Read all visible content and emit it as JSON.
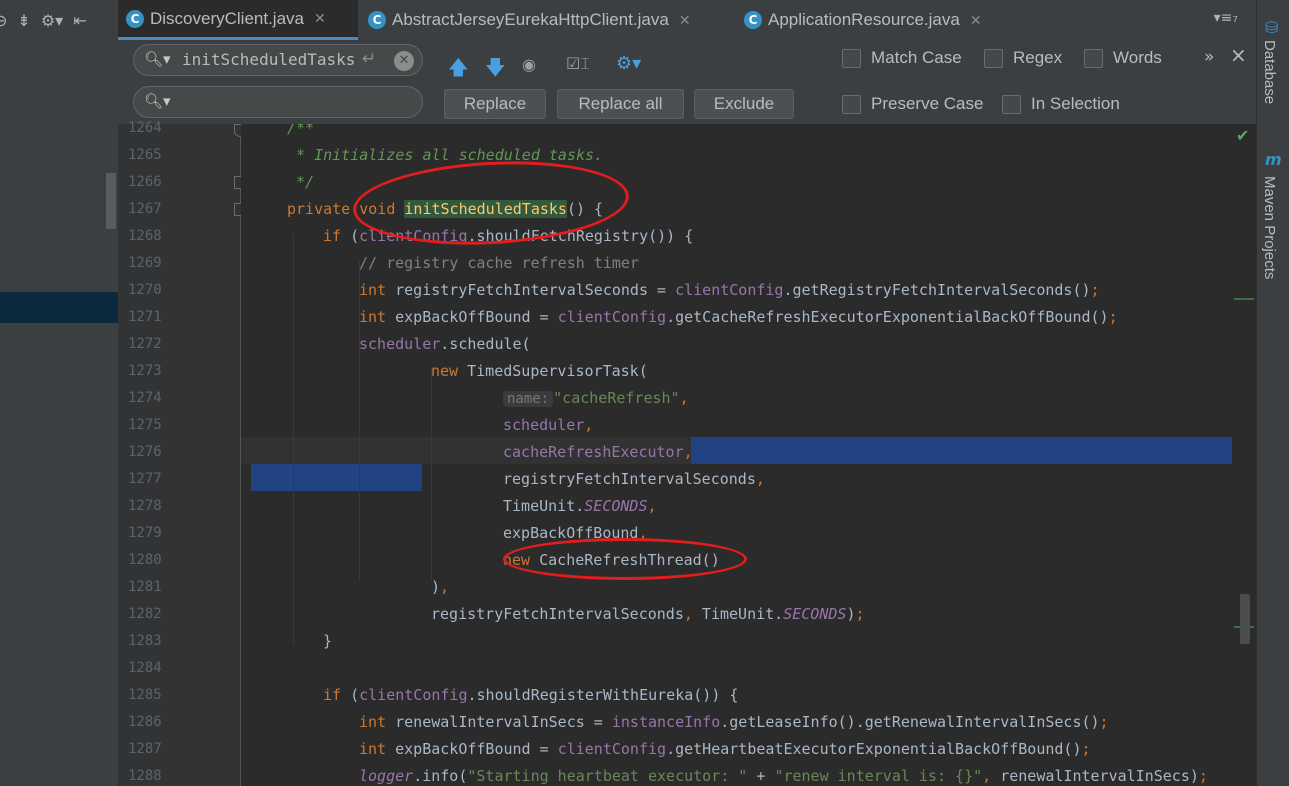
{
  "toolbar": {
    "icons": [
      "globe-icon",
      "collapse-icon",
      "gear-icon",
      "hide-icon"
    ]
  },
  "tabs": [
    {
      "label": "DiscoveryClient.java",
      "icon": "C",
      "active": true
    },
    {
      "label": "AbstractJerseyEurekaHttpClient.java",
      "icon": "C",
      "active": false
    },
    {
      "label": "ApplicationResource.java",
      "icon": "C",
      "active": false
    }
  ],
  "tab_menu": "▾≡₇",
  "find": {
    "search_value": "initScheduledTasks",
    "replace_value": "",
    "buttons": {
      "replace": "Replace",
      "replace_all": "Replace all",
      "exclude": "Exclude"
    },
    "options": {
      "match_case": "Match Case",
      "regex": "Regex",
      "words": "Words",
      "preserve_case": "Preserve Case",
      "in_selection": "In Selection"
    },
    "more": "»",
    "close": "×"
  },
  "gutter": {
    "lines": [
      "1264",
      "1265",
      "1266",
      "1267",
      "1268",
      "1269",
      "1270",
      "1271",
      "1272",
      "1273",
      "1274",
      "1275",
      "1276",
      "1277",
      "1278",
      "1279",
      "1280",
      "1281",
      "1282",
      "1283",
      "1284",
      "1285",
      "1286",
      "1287",
      "1288"
    ]
  },
  "code": {
    "l1264": "/**",
    "l1265": " * Initializes all scheduled tasks.",
    "l1266": " */",
    "l1267": {
      "kw1": "private",
      "kw2": "void",
      "name": "initScheduledTasks",
      "rest": "() {"
    },
    "l1268": {
      "kw": "if",
      "open": " (",
      "field": "clientConfig",
      "rest": ".shouldFetchRegistry()) {"
    },
    "l1269": "// registry cache refresh timer",
    "l1270": {
      "kw": "int",
      "mid": " registryFetchIntervalSeconds = ",
      "field": "clientConfig",
      "rest": ".getRegistryFetchIntervalSeconds()",
      "semi": ";"
    },
    "l1271": {
      "kw": "int",
      "mid": " expBackOffBound = ",
      "field": "clientConfig",
      "rest": ".getCacheRefreshExecutorExponentialBackOffBound()",
      "semi": ";"
    },
    "l1272": {
      "field": "scheduler",
      "rest": ".schedule("
    },
    "l1273": {
      "kw": "new",
      "rest": " TimedSupervisorTask("
    },
    "l1274": {
      "hint": "name:",
      "str": "\"cacheRefresh\"",
      "comma": ","
    },
    "l1275": {
      "field": "scheduler",
      "comma": ","
    },
    "l1276": {
      "field": "cacheRefreshExecutor",
      "comma": ","
    },
    "l1277": {
      "text": "registryFetchIntervalSeconds",
      "comma": ","
    },
    "l1278": {
      "text": "TimeUnit.",
      "stat": "SECONDS",
      "comma": ","
    },
    "l1279": {
      "text": "expBackOffBound",
      "comma": ","
    },
    "l1280": {
      "kw": "new",
      "rest": " CacheRefreshThread()"
    },
    "l1281": {
      "text": ")",
      "comma": ","
    },
    "l1282": {
      "text": "registryFetchIntervalSeconds",
      "comma": ",",
      "text2": " TimeUnit.",
      "stat": "SECONDS",
      "close": ")",
      "semi": ";"
    },
    "l1283": "}",
    "l1285": {
      "kw": "if",
      "open": " (",
      "field": "clientConfig",
      "rest": ".shouldRegisterWithEureka()) {"
    },
    "l1286": {
      "kw": "int",
      "mid": " renewalIntervalInSecs = ",
      "field": "instanceInfo",
      "rest": ".getLeaseInfo().getRenewalIntervalInSecs()",
      "semi": ";"
    },
    "l1287": {
      "kw": "int",
      "mid": " expBackOffBound = ",
      "field": "clientConfig",
      "rest": ".getHeartbeatExecutorExponentialBackOffBound()",
      "semi": ";"
    },
    "l1288": {
      "stat": "logger",
      "mid": ".info(",
      "str1": "\"Starting heartbeat executor: \"",
      "plus": " + ",
      "str2": "\"renew interval is: {}\"",
      "comma": ",",
      "rest": " renewalIntervalInSecs)",
      "semi": ";"
    }
  },
  "sidebar": {
    "database": "Database",
    "maven": "Maven Projects",
    "maven_icon": "m"
  },
  "colors": {
    "annotation": "#e31d1d",
    "selection": "#214283",
    "match_highlight": "#32593d"
  }
}
